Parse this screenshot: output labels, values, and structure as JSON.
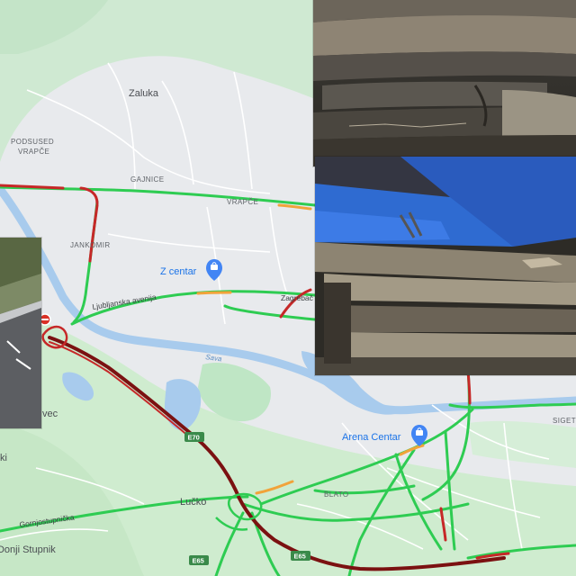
{
  "map": {
    "districts": {
      "zaluka": "Zaluka",
      "podsused": "PODSUSED",
      "vrapce_left": "VRAPČE",
      "gajnice": "GAJNICE",
      "vrapce_right": "VRAPČE",
      "jankomir": "JANKOMIR",
      "blato": "BLATO",
      "siget": "SIGET"
    },
    "towns": {
      "lucko": "Lučko",
      "donji_stupnik": "Donji Stupnik",
      "vec": "vec",
      "ki": "ki"
    },
    "streets": {
      "ljubljanska": "Ljubljanska avenija",
      "zagrebac": "Zagrebač",
      "gornjostupnicka": "Gornjostupnička"
    },
    "river": "Sava",
    "places": {
      "z_centar": "Z centar",
      "arena_centar": "Arena Centar"
    },
    "route_shields": {
      "e70": "E70",
      "e65_a": "E65",
      "e65_b": "E65"
    },
    "colors": {
      "traffic_free": "#2ecc52",
      "traffic_slow": "#f1a33a",
      "traffic_heavy": "#c62828",
      "traffic_severe": "#7b1111",
      "water": "#a8cbed",
      "park": "#bfe6c5",
      "poi_marker": "#4285f4",
      "closure_marker": "#d93025"
    },
    "icons": [
      "shopping-bag-icon",
      "road-closure-icon"
    ]
  },
  "photos": [
    {
      "name": "bridge-damage-photo-top",
      "subject": "concrete bridge slab crack"
    },
    {
      "name": "bridge-damage-photo-middle",
      "subject": "crumbling bridge bearing with blue steel beam"
    },
    {
      "name": "highway-photo-left",
      "subject": "highway lane with barrier"
    }
  ]
}
